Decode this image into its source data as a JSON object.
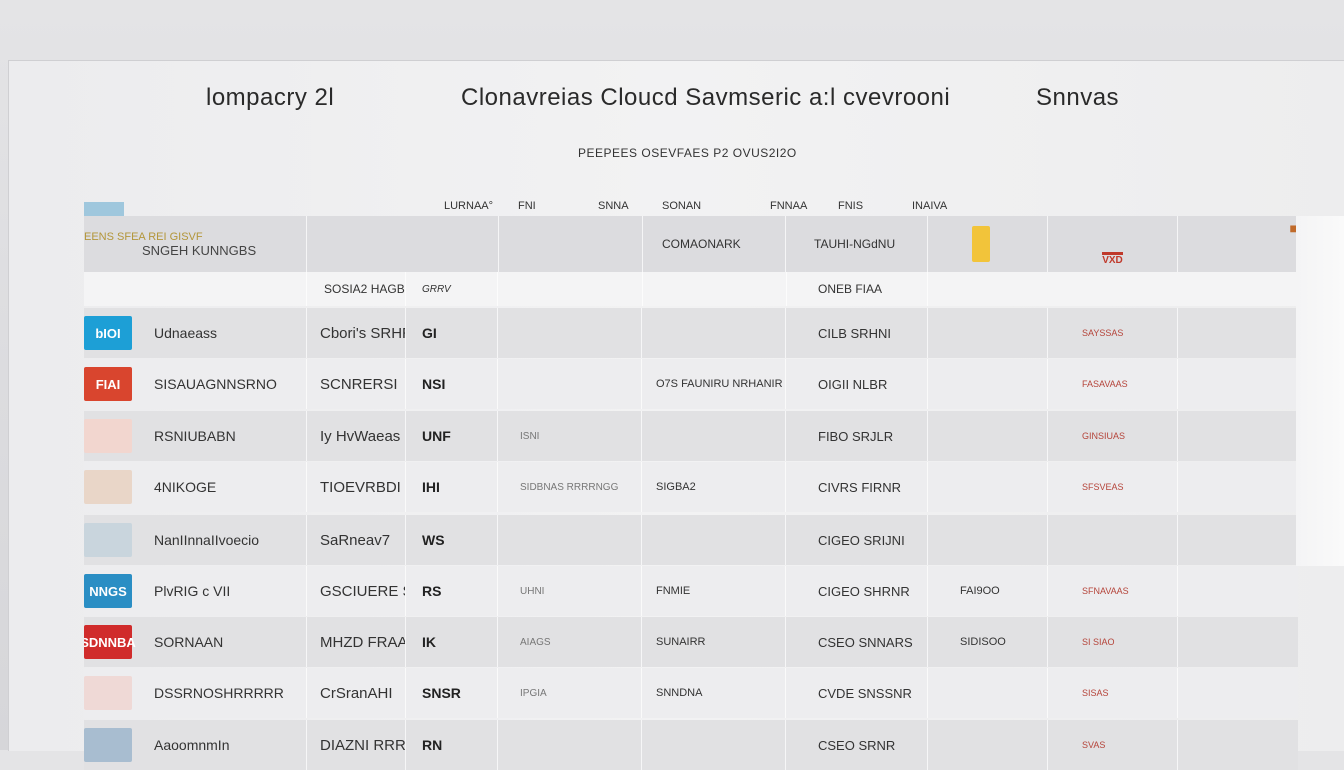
{
  "header": {
    "left": "lompacry 2l",
    "center": "Clonavreias  Cloucd  Savmseric  a:l  cvevrooni",
    "right": "Snnvas",
    "subtitle": "PEEPEES OSEVFAES P2 OVUS2I2O"
  },
  "columns": [
    "LURNAA°",
    "FNI",
    "SNNA",
    "SONAN",
    "FNNAA",
    "FNIS",
    "INAIVA"
  ],
  "top_block": {
    "brand_line": "EENS SFEA REI GISVF",
    "brand_sub": "SNGEH KUNNGBS",
    "col4": "COMAONARK",
    "col5": "TAUHI-NGdNU",
    "badge": "VXD"
  },
  "summary_row": {
    "col2": "SOSIA2 HAGB",
    "col3": "GRRV",
    "col5": "ONEB FIAA"
  },
  "rows": [
    {
      "logo_text": "bIOI",
      "logo_color": "#1d9fd6",
      "name": "Udnaeass",
      "c2": "Cbori's SRHR",
      "c3": "GI",
      "c4": "",
      "c5": "",
      "c6": "CILB SRHNI",
      "c7": "",
      "c8": "SAYSSAS"
    },
    {
      "logo_text": "FIAI",
      "logo_color": "#d9452e",
      "name": "SISAUAGNNSRNO",
      "c2": "SCNRERSI",
      "c3": "NSI",
      "c4": "",
      "c5": "O7S FAUNIRU NRHANIR",
      "c6": "OIGII NLBR",
      "c7": "",
      "c8": "FASAVAAS"
    },
    {
      "logo_text": "",
      "logo_color": "#f2d6cf",
      "name": "RSNIUBABN",
      "c2": "Iy HvWaeas",
      "c3": "UNF",
      "c4": "ISNI",
      "c5": "",
      "c6": "FIBO SRJLR",
      "c7": "",
      "c8": "GINSIUAS"
    },
    {
      "logo_text": "",
      "logo_color": "#e9d6c8",
      "name": "4NIKOGE",
      "c2": "TIOEVRBDI",
      "c3": "IHI",
      "c4": "SIDBNAS RRRRNGG",
      "c5": "SIGBA2",
      "c6": "CIVRS FIRNR",
      "c7": "",
      "c8": "SFSVEAS"
    },
    {
      "logo_text": "",
      "logo_color": "#c9d5dd",
      "name": "NanIInnaIIvoecio",
      "c2": "SaRneav7",
      "c3": "WS",
      "c4": "",
      "c5": "",
      "c6": "CIGEO SRIJNI",
      "c7": "",
      "c8": ""
    },
    {
      "logo_text": "NNGS",
      "logo_color": "#2a8ec4",
      "name": "PlvRIG c VII",
      "c2": "GSCIUERE SENGI",
      "c3": "RS",
      "c4": "UHNI",
      "c5": "FNMIE",
      "c6": "CIGEO SHRNR",
      "c7": "FAI9OO",
      "c8": "SFNAVAAS"
    },
    {
      "logo_text": "SDNNBA",
      "logo_color": "#d02b2b",
      "name": "SORNAAN",
      "c2": "MHZD FRAAN",
      "c3": "IK",
      "c4": "AIAGS",
      "c5": "SUNAIRR",
      "c6": "CSEO SNNARS",
      "c7": "SIDISOO",
      "c8": "SI SIAO"
    },
    {
      "logo_text": "",
      "logo_color": "#efd9d6",
      "name": "DSSRNOSHRRRRR",
      "c2": "CrSranAHI",
      "c3": "SNSR",
      "c4": "IPGIA",
      "c5": "SNNDNA",
      "c6": "CVDE SNSSNR",
      "c7": "",
      "c8": "SISAS"
    },
    {
      "logo_text": "",
      "logo_color": "#a8bdd0",
      "name": "AaoomnmIn",
      "c2": "DIAZNI RRRRR",
      "c3": "RN",
      "c4": "",
      "c5": "",
      "c6": "CSEO SRNR",
      "c7": "",
      "c8": "SVAS"
    }
  ],
  "colors": {
    "accent_blue": "#1d9fd6",
    "accent_red": "#c0392b",
    "row_dark": "#dcdcdf",
    "row_light": "#ebebed"
  }
}
